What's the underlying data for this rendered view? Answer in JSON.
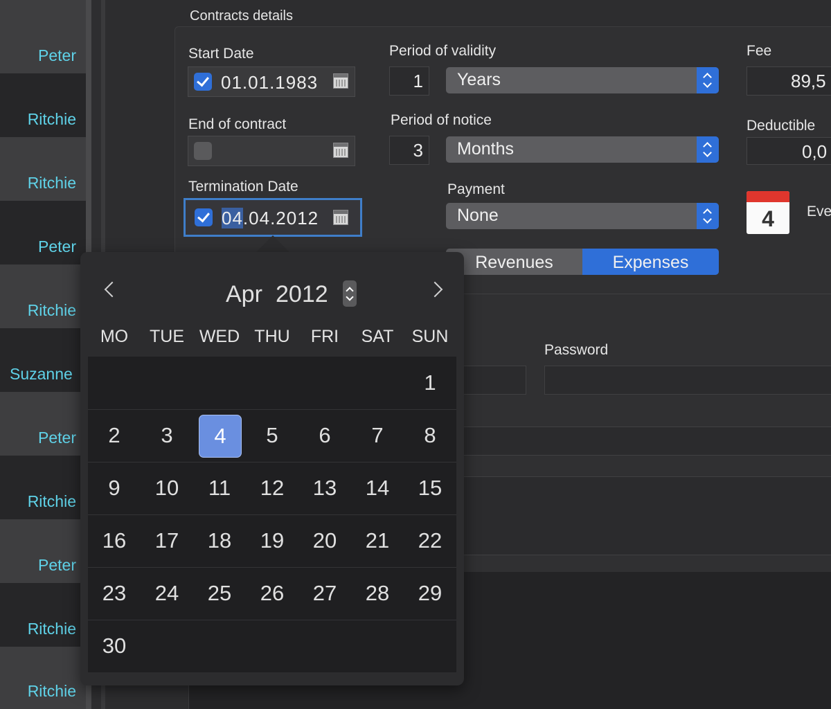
{
  "left_list": {
    "names": [
      "Peter",
      "Ritchie",
      "Ritchie",
      "Peter",
      "Ritchie",
      "Suzanne",
      "Peter",
      "Ritchie",
      "Peter",
      "Ritchie",
      "Ritchie"
    ]
  },
  "contracts": {
    "section_title": "Contracts details",
    "start_date": {
      "label": "Start Date",
      "value": "01.01.1983",
      "checked": true
    },
    "end_of_contract": {
      "label": "End of contract",
      "value": "",
      "checked": false
    },
    "termination_date": {
      "label": "Termination Date",
      "value_selected": "04",
      "value_rest": ".04.2012",
      "checked": true
    },
    "period_of_validity": {
      "label": "Period of validity",
      "number": "1",
      "unit": "Years"
    },
    "period_of_notice": {
      "label": "Period of notice",
      "number": "3",
      "unit": "Months"
    },
    "payment": {
      "label": "Payment",
      "value": "None"
    },
    "segmented": {
      "revenues": "Revenues",
      "expenses": "Expenses",
      "selected": "Expenses"
    },
    "fee": {
      "label": "Fee",
      "value": "89,5"
    },
    "deductible": {
      "label": "Deductible",
      "value": "0,0"
    },
    "event": {
      "icon_day": "4",
      "label": "Eve"
    },
    "password": {
      "label": "Password"
    }
  },
  "calendar": {
    "month": "Apr",
    "year": "2012",
    "weekdays": [
      "MO",
      "TUE",
      "WED",
      "THU",
      "FRI",
      "SAT",
      "SUN"
    ],
    "weeks": [
      [
        "",
        "",
        "",
        "",
        "",
        "",
        "1"
      ],
      [
        "2",
        "3",
        "4",
        "5",
        "6",
        "7",
        "8"
      ],
      [
        "9",
        "10",
        "11",
        "12",
        "13",
        "14",
        "15"
      ],
      [
        "16",
        "17",
        "18",
        "19",
        "20",
        "21",
        "22"
      ],
      [
        "23",
        "24",
        "25",
        "26",
        "27",
        "28",
        "29"
      ],
      [
        "30",
        "",
        "",
        "",
        "",
        "",
        ""
      ]
    ],
    "selected_day": "4"
  },
  "colors": {
    "accent": "#2f6fd8",
    "name_text": "#5fd2e8",
    "selected_day": "#6a8fe0"
  }
}
